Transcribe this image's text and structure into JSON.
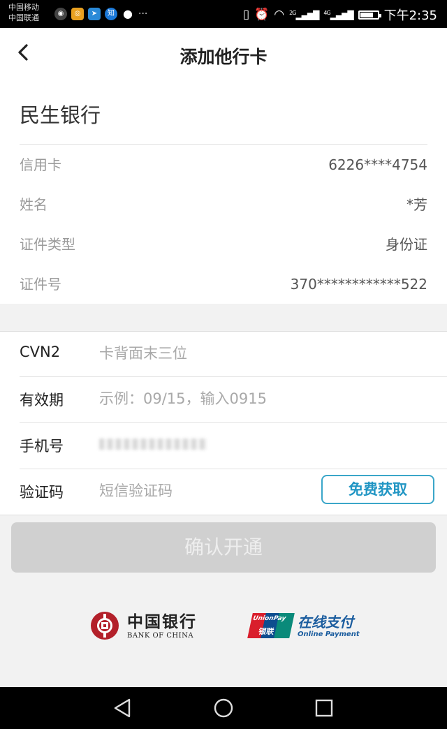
{
  "status_bar": {
    "carrier1": "中国移动",
    "carrier2": "中国联通",
    "notif_zhihu": "知",
    "more": "···",
    "network1": "2G",
    "network2": "4G",
    "time": "下午2:35"
  },
  "nav": {
    "back_glyph": "‹",
    "title": "添加他行卡"
  },
  "card": {
    "bank_name": "民生银行",
    "rows": [
      {
        "label": "信用卡",
        "value": "6226****4754"
      },
      {
        "label": "姓名",
        "value": "*芳"
      },
      {
        "label": "证件类型",
        "value": "身份证"
      },
      {
        "label": "证件号",
        "value": "370************522"
      }
    ]
  },
  "form": {
    "cvn2_label": "CVN2",
    "cvn2_placeholder": "卡背面末三位",
    "expiry_label": "有效期",
    "expiry_placeholder": "示例：09/15，输入0915",
    "phone_label": "手机号",
    "code_label": "验证码",
    "code_placeholder": "短信验证码",
    "get_code_button": "免费获取"
  },
  "confirm_button": "确认开通",
  "logos": {
    "boc_cn": "中国银行",
    "boc_en": "BANK OF CHINA",
    "unionpay_name": "UnionPay",
    "unionpay_yinlian": "银联",
    "unionpay_cn": "在线支付",
    "unionpay_en": "Online Payment"
  },
  "colors": {
    "accent": "#2296c4",
    "boc_red": "#b3202a",
    "disabled_button": "#d0d0d0"
  }
}
